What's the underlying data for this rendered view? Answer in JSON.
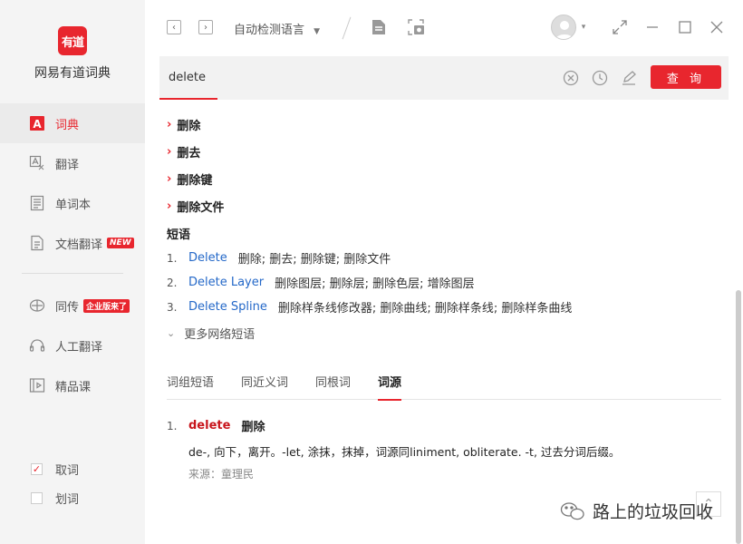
{
  "app": {
    "logo_text": "有道",
    "name": "网易有道词典"
  },
  "sidebar": {
    "items": [
      {
        "label": "词典",
        "icon": "dictionary-icon",
        "active": true
      },
      {
        "label": "翻译",
        "icon": "translate-icon"
      },
      {
        "label": "单词本",
        "icon": "wordbook-icon"
      },
      {
        "label": "文档翻译",
        "icon": "document-translate-icon",
        "badge": "NEW"
      },
      {
        "label": "同传",
        "icon": "simultaneous-icon",
        "badge": "企业版来了"
      },
      {
        "label": "人工翻译",
        "icon": "human-translate-icon"
      },
      {
        "label": "精品课",
        "icon": "course-icon"
      }
    ],
    "checks": [
      {
        "label": "取词",
        "checked": true
      },
      {
        "label": "划词",
        "checked": false
      }
    ]
  },
  "topbar": {
    "language": "自动检测语言"
  },
  "search": {
    "query": "delete",
    "button": "查 询"
  },
  "definitions": [
    "删除",
    "删去",
    "删除键",
    "删除文件"
  ],
  "phrases": {
    "title": "短语",
    "items": [
      {
        "num": "1.",
        "term": "Delete",
        "meaning": "删除;  删去;  删除键;  删除文件"
      },
      {
        "num": "2.",
        "term": "Delete Layer",
        "meaning": "删除图层;  删除层;  删除色层;  增除图层"
      },
      {
        "num": "3.",
        "term": "Delete Spline",
        "meaning": "删除样条线修改器;  删除曲线;  删除样条线;  删除样条曲线"
      }
    ],
    "more": "更多网络短语"
  },
  "tabs": [
    "词组短语",
    "同近义词",
    "同根词",
    "词源"
  ],
  "etymology": {
    "num": "1.",
    "word": "delete",
    "meaning": "删除",
    "text": "de-, 向下，离开。-let, 涂抹，抹掉，词源同liniment, obliterate. -t, 过去分词后缀。",
    "source": "来源：童理民"
  },
  "watermark": "路上的垃圾回收",
  "colors": {
    "accent": "#e8262e",
    "link": "#2468c8"
  }
}
